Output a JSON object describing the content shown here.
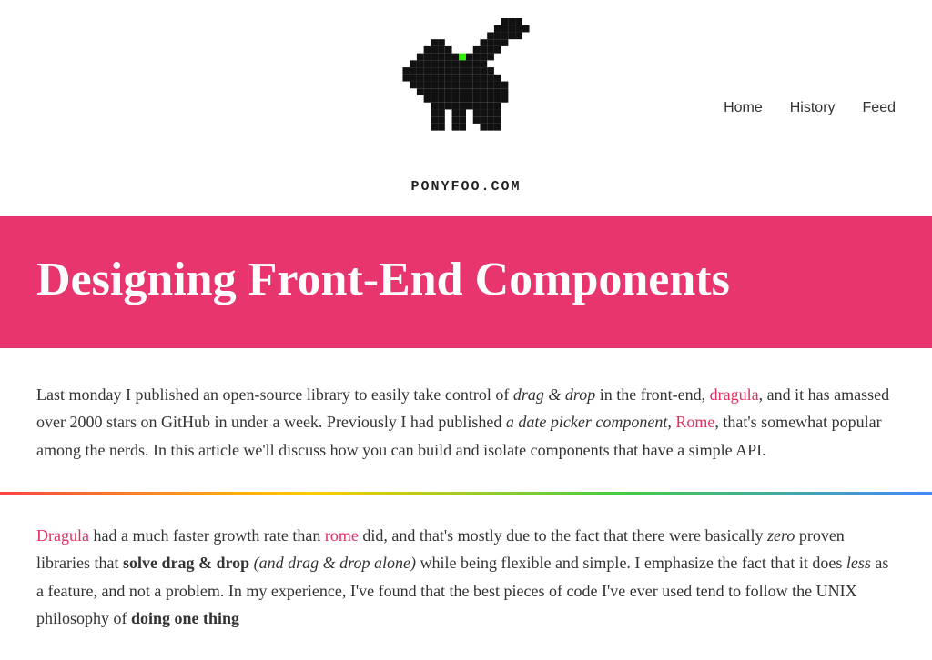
{
  "site": {
    "name": "PONYFOO.COM",
    "logo_alt": "Ponyfoo pixel art logo"
  },
  "nav": {
    "home_label": "Home",
    "history_label": "History",
    "feed_label": "Feed"
  },
  "hero": {
    "title": "Designing Front-End Components"
  },
  "intro": {
    "text_before_italic": "Last monday I published an open-source library to easily take control of ",
    "italic_text": "drag & drop",
    "text_after_italic": " in the front-end, ",
    "link1_text": "dragula",
    "link1_url": "#",
    "text_middle": ", and it has amassed over 2000 stars on GitHub in under a week. Previously I had published ",
    "italic2_text": "a date picker component",
    "text_before_link2": ", ",
    "link2_text": "Rome",
    "link2_url": "#",
    "text_end": ", that’s somewhat popular among the nerds. In this article we’ll discuss how you can build and isolate components that have a simple API."
  },
  "body": {
    "link1_text": "Dragula",
    "text1": " had a much faster growth rate than ",
    "link2_text": "rome",
    "text2": " did, and that’s mostly due to the fact that there were basically ",
    "italic1": "zero",
    "text3": " proven libraries that ",
    "bold1": "solve drag & drop",
    "italic2": " (and drag & drop alone)",
    "text4": " while being flexible and simple. I emphasize the fact that it does ",
    "italic3": "less",
    "text5": " as a feature, and not a problem. In my experience, I’ve found that the best pieces of code I’ve ever used tend to follow the UNIX philosophy of ",
    "bold2": "doing one thing"
  },
  "colors": {
    "accent": "#e8356d",
    "link": "#e03060",
    "link_secondary": "#e03060"
  }
}
